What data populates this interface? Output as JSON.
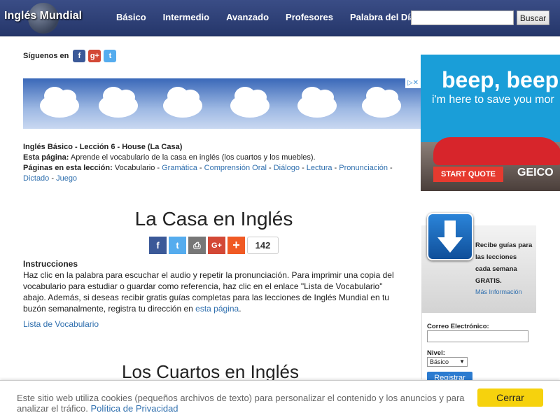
{
  "header": {
    "logo": "Inglés Mundial",
    "nav": [
      "Básico",
      "Intermedio",
      "Avanzado",
      "Profesores",
      "Palabra del Día"
    ],
    "search_button": "Buscar",
    "bg": "#2c3e73"
  },
  "follow": {
    "label": "Síguenos en"
  },
  "lesson": {
    "title": "Inglés Básico - Lección 6 - House (La Casa)",
    "page_label": "Esta página:",
    "page_text": "Aprende el vocabulario de la casa en inglés (los cuartos y los muebles).",
    "pages_label": "Páginas en esta lección:",
    "current": "Vocabulario",
    "links": [
      "Gramática",
      "Comprensión Oral",
      "Diálogo",
      "Lectura",
      "Pronunciación",
      "Dictado",
      "Juego"
    ]
  },
  "main": {
    "title": "La Casa en Inglés",
    "share_count": "142",
    "instructions_title": "Instrucciones",
    "instructions_text": "Haz clic en la palabra para escuchar el audio y repetir la pronunciación. Para imprimir una copia del vocabulario para estudiar o guardar como referencia, haz clic en el enlace \"Lista de Vocabulario\" abajo. Además, si deseas recibir gratis guías completas para las lecciones de Inglés Mundial en tu buzón semanalmente, registra tu dirección en",
    "instructions_link": "esta página",
    "vocab_link": "Lista de Vocabulario",
    "subtitle": "Los Cuartos en Inglés"
  },
  "side_ad": {
    "line1": "beep, beep",
    "line2": "i'm here to save you mor",
    "cta": "START QUOTE",
    "brand": "GEICO"
  },
  "signup": {
    "text": "Recibe guías para las lecciones cada semana GRATIS.",
    "more": "Más Información",
    "email_label": "Correo Electrónico:",
    "level_label": "Nivel:",
    "level_value": "Básico",
    "register": "Registrar"
  },
  "cookie": {
    "text": "Este sitio web utiliza cookies (pequeños archivos de texto) para personalizar el contenido y los anuncios y para analizar el tráfico.",
    "link": "Política de Privacidad",
    "close": "Cerrar"
  }
}
